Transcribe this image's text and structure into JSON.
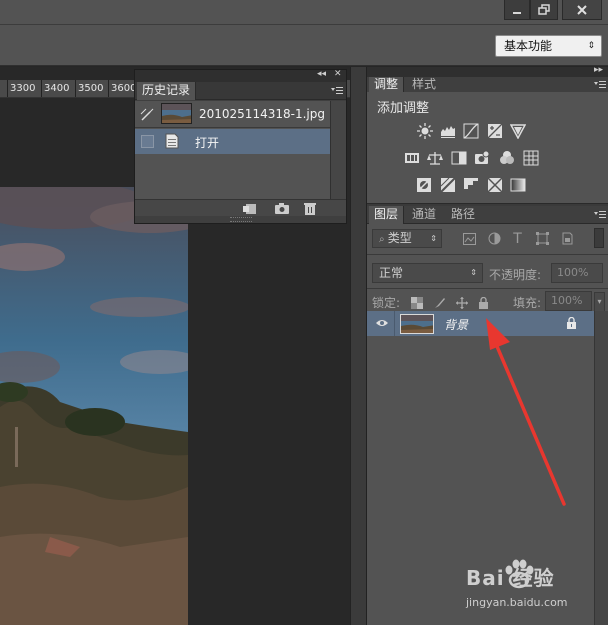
{
  "workspace": {
    "label": "基本功能"
  },
  "ruler": {
    "ticks": [
      "3300",
      "3400",
      "3500",
      "3600"
    ]
  },
  "history_panel": {
    "tab_label": "历史记录",
    "snapshot_name": "201025114318-1.jpg",
    "steps": [
      {
        "label": "打开"
      }
    ]
  },
  "adjustments_panel": {
    "tabs": [
      "调整",
      "样式"
    ],
    "title": "添加调整"
  },
  "layers_panel": {
    "tabs": [
      "图层",
      "通道",
      "路径"
    ],
    "filter_label": "类型",
    "blend_mode": "正常",
    "opacity_label": "不透明度:",
    "opacity_value": "100%",
    "lock_label": "锁定:",
    "fill_label": "填充:",
    "fill_value": "100%",
    "layers": [
      {
        "name": "背景",
        "locked": true,
        "visible": true
      }
    ]
  },
  "watermark": {
    "brand": "Bai 经验",
    "url": "jingyan.baidu.com"
  },
  "colors": {
    "selection": "#5c6f86",
    "panel": "#535353",
    "annotation": "#e8372f"
  }
}
